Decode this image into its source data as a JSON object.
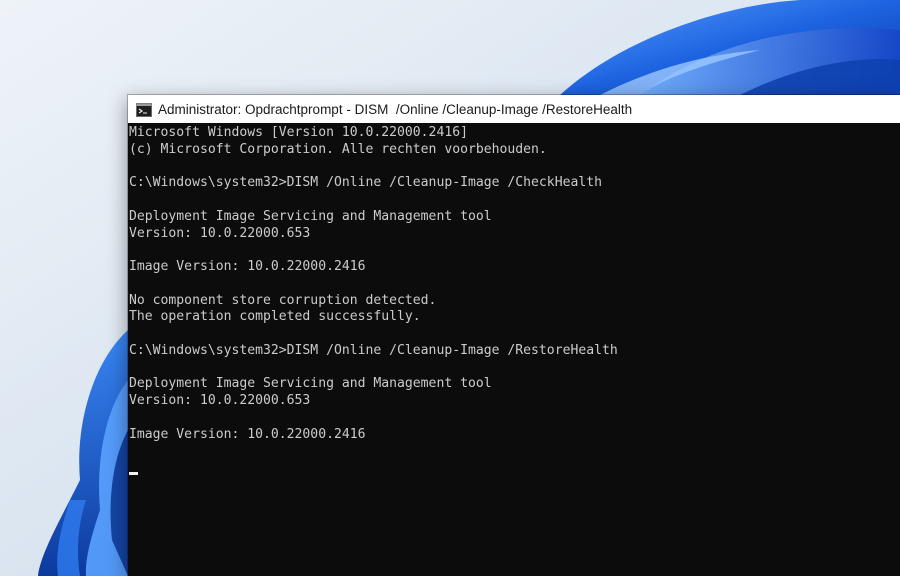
{
  "window": {
    "title": "Administrator: Opdrachtprompt - DISM  /Online /Cleanup-Image /RestoreHealth",
    "icon": "cmd-icon"
  },
  "console": {
    "lines": [
      "Microsoft Windows [Version 10.0.22000.2416]",
      "(c) Microsoft Corporation. Alle rechten voorbehouden.",
      "",
      "C:\\Windows\\system32>DISM /Online /Cleanup-Image /CheckHealth",
      "",
      "Deployment Image Servicing and Management tool",
      "Version: 10.0.22000.653",
      "",
      "Image Version: 10.0.22000.2416",
      "",
      "No component store corruption detected.",
      "The operation completed successfully.",
      "",
      "C:\\Windows\\system32>DISM /Online /Cleanup-Image /RestoreHealth",
      "",
      "Deployment Image Servicing and Management tool",
      "Version: 10.0.22000.653",
      "",
      "Image Version: 10.0.22000.2416",
      ""
    ],
    "text_color": "#cccccc",
    "background": "#0c0c0c"
  },
  "colors": {
    "wallpaper": "#dfe8f2",
    "accent_blue": "#1a5fd8"
  }
}
